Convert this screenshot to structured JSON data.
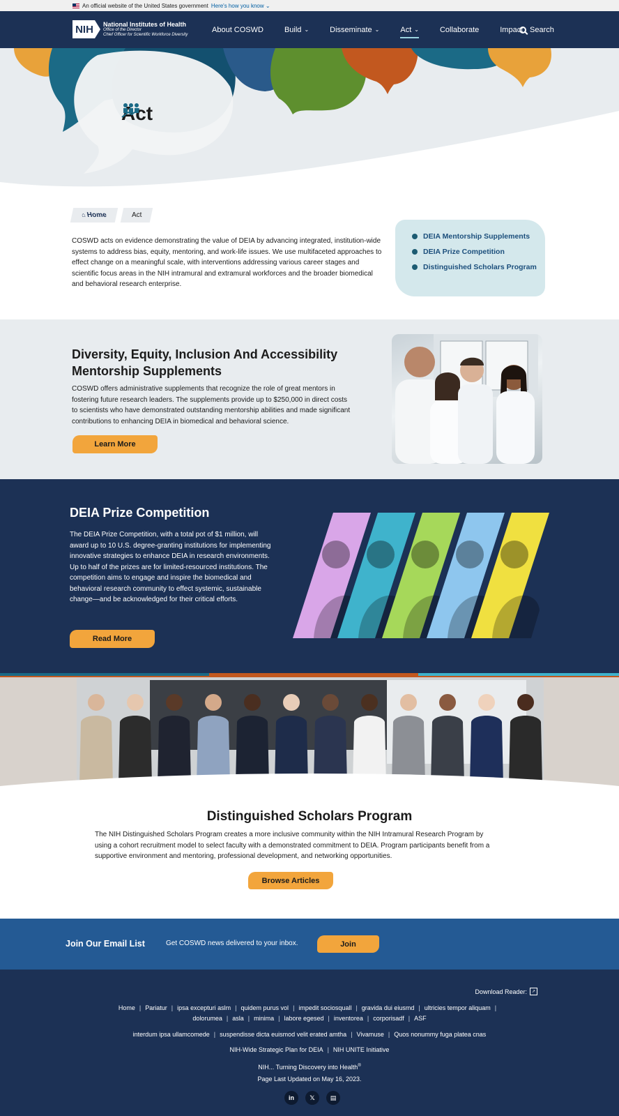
{
  "gov_banner": {
    "text": "An official website of the United States government",
    "link": "Here's how you know"
  },
  "header": {
    "logo_mark": "NIH",
    "org": "National Institutes of Health",
    "office": "Office of the Director",
    "sub_office": "Chief Officer for Scientific Workforce Diversity",
    "nav": [
      {
        "label": "About COSWD",
        "dropdown": false
      },
      {
        "label": "Build",
        "dropdown": true
      },
      {
        "label": "Disseminate",
        "dropdown": true
      },
      {
        "label": "Act",
        "dropdown": true,
        "active": true
      },
      {
        "label": "Collaborate",
        "dropdown": false
      },
      {
        "label": "Impact",
        "dropdown": false
      }
    ],
    "search_label": "Search"
  },
  "hero": {
    "title": "Act",
    "icon": "people-growth-icon"
  },
  "breadcrumb": {
    "home": "Home",
    "current": "Act"
  },
  "intro": {
    "text": "COSWD acts on evidence demonstrating the value of DEIA by advancing integrated, institution-wide systems to address bias, equity, mentoring, and work-life issues. We use multifaceted approaches to effect change on a meaningful scale, with interventions addressing various career stages and scientific focus areas in the NIH intramural and extramural workforces and the broader biomedical and behavioral research enterprise."
  },
  "quick_links": [
    "DEIA Mentorship Supplements",
    "DEIA Prize Competition",
    "Distinguished Scholars Program"
  ],
  "mentorship": {
    "title": "Diversity, Equity, Inclusion And Accessibility Mentorship Supplements",
    "text": "COSWD offers administrative supplements that recognize the role of great mentors in fostering future research leaders. The supplements provide up to $250,000 in direct costs to scientists who have demonstrated outstanding mentorship abilities and made significant contributions to enhancing DEIA in biomedical and behavioral science.",
    "button": "Learn More"
  },
  "prize": {
    "title": "DEIA Prize Competition",
    "text": "The DEIA Prize Competition, with a total pot of  $1 million, will award up to 10 U.S. degree-granting institutions for implementing innovative strategies to enhance DEIA in research environments. Up to half of the prizes are for limited-resourced institutions. The competition aims to engage and inspire the biomedical and behavioral research community to effect systemic, sustainable change—and be acknowledged for their critical efforts.",
    "button": "Read More",
    "strip_colors": [
      "#d9a6e8",
      "#3fb3cc",
      "#a6d85a",
      "#8ec6ee",
      "#f0e040"
    ]
  },
  "scholars": {
    "title": "Distinguished Scholars Program",
    "text": "The NIH Distinguished Scholars Program creates a more inclusive community within the NIH Intramural Research Program by using a cohort recruitment model to select faculty with a demonstrated commitment to DEIA. Program participants benefit from a supportive environment and mentoring, professional development, and networking opportunities.",
    "button": "Browse Articles"
  },
  "email": {
    "title": "Join Our Email List",
    "desc": "Get COSWD news delivered to your inbox.",
    "button": "Join"
  },
  "footer": {
    "download_reader": "Download Reader:",
    "links_row1": [
      "Home",
      "Pariatur",
      "ipsa excepturi aslm",
      "quidem purus vol",
      "impedit sociosquall",
      "gravida dui eiusmd",
      "ultricies tempor aliquam",
      "dolorumea",
      "asla",
      "minima",
      "labore egesed",
      "inventorea",
      "corporisadf",
      "ASF"
    ],
    "links_row2": [
      "interdum ipsa ullamcomede",
      "suspendisse dicta euismod velit erated amtha",
      "Vivamuse",
      "Quos nonummy fuga platea  cnas"
    ],
    "links_row3": [
      "NIH-Wide Strategic Plan for DEIA",
      "NIH UNITE Initiative"
    ],
    "tagline": "NIH... Turning Discovery into Health",
    "tagline_mark": "®",
    "updated": "Page Last Updated on May 16, 2023.",
    "social": [
      {
        "label": "in",
        "icon": "linkedin-icon"
      },
      {
        "label": "𝕏",
        "icon": "x-icon"
      },
      {
        "label": "▤",
        "icon": "document-icon"
      }
    ]
  }
}
